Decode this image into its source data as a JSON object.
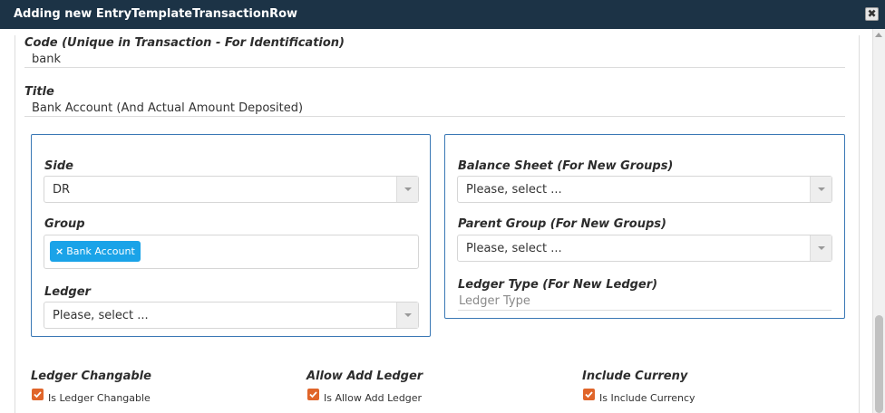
{
  "dialog": {
    "title": "Adding new EntryTemplateTransactionRow",
    "close_label": "✖"
  },
  "code": {
    "label": "Code (Unique in Transaction - For Identification)",
    "value": "bank"
  },
  "title_field": {
    "label": "Title",
    "value": "Bank Account (And Actual Amount Deposited)"
  },
  "left_box": {
    "side": {
      "label": "Side",
      "value": "DR"
    },
    "group": {
      "label": "Group",
      "tags": [
        "Bank Account"
      ],
      "tag_remove": "×"
    },
    "ledger": {
      "label": "Ledger",
      "value": "Please, select ..."
    }
  },
  "right_box": {
    "balance_sheet": {
      "label": "Balance Sheet (For New Groups)",
      "value": "Please, select ..."
    },
    "parent_group": {
      "label": "Parent Group (For New Groups)",
      "value": "Please, select ..."
    },
    "ledger_type": {
      "label": "Ledger Type (For New Ledger)",
      "placeholder": "Ledger Type"
    }
  },
  "options": {
    "ledger_changable": {
      "label": "Ledger Changable",
      "checkbox_label": "Is Ledger Changable",
      "checked": true
    },
    "allow_add_ledger": {
      "label": "Allow Add Ledger",
      "checkbox_label": "Is Allow Add Ledger",
      "checked": true
    },
    "include_currency": {
      "label": "Include Curreny",
      "checkbox_label": "Is Include Currency",
      "checked": true
    }
  },
  "colors": {
    "titlebar": "#1c3346",
    "box_border": "#3a78b5",
    "tag": "#1aa3e8",
    "checkbox": "#e0652a"
  }
}
